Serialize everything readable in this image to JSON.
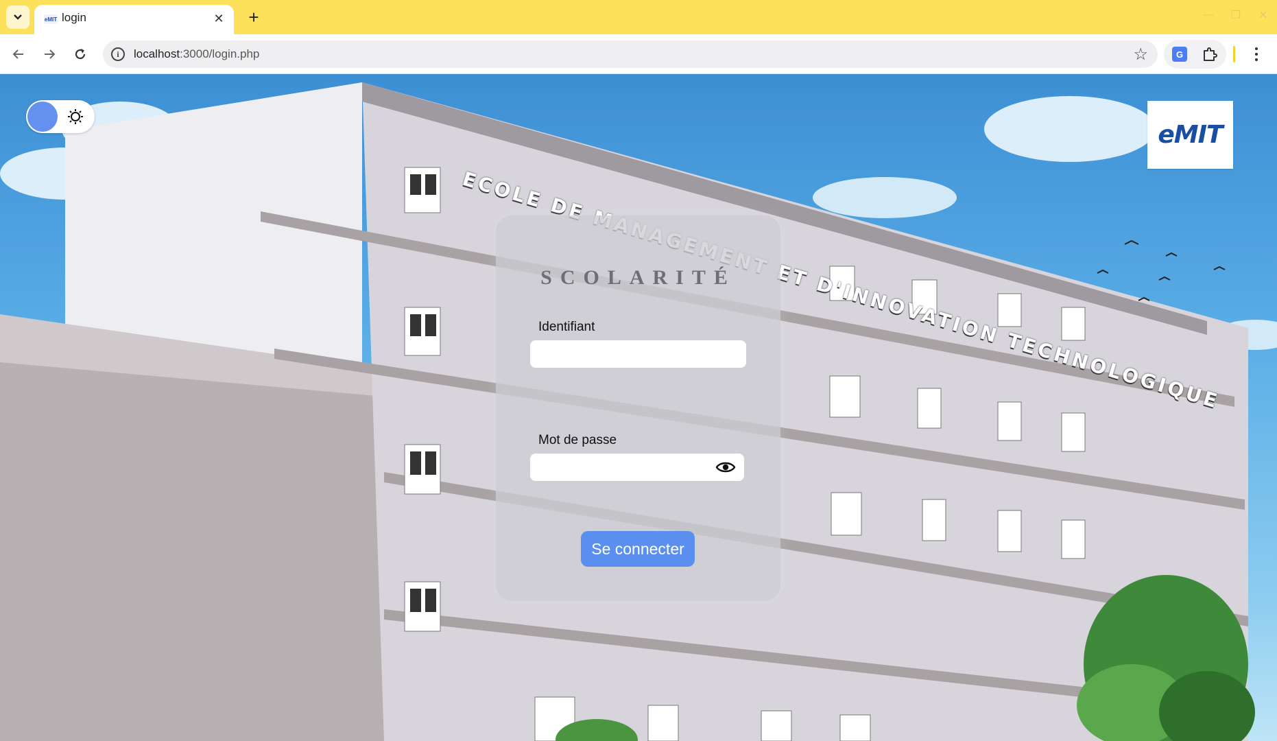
{
  "browser": {
    "tab_title": "login",
    "favicon_text": "eMIT",
    "url_host": "localhost",
    "url_path": ":3000/login.php",
    "new_tab_symbol": "+",
    "close_symbol": "✕"
  },
  "page": {
    "building_sign": "ECOLE DE MANAGEMENT ET D'INNOVATION TECHNOLOGIQUE",
    "logo": {
      "text": "eMIT"
    }
  },
  "login": {
    "title": "SCOLARITÉ",
    "username_label": "Identifiant",
    "username_value": "",
    "password_label": "Mot de passe",
    "password_value": "",
    "submit_label": "Se connecter"
  },
  "theme": {
    "accent": "#5a8ff0",
    "toggle_knob": "#6590f0",
    "tabbar": "#fde15b",
    "mode": "light"
  },
  "icons": [
    "tab-dropdown-icon",
    "back-icon",
    "forward-icon",
    "reload-icon",
    "info-icon",
    "bookmark-star-icon",
    "google-translate-icon",
    "extensions-puzzle-icon",
    "kebab-menu-icon",
    "sun-icon",
    "eye-icon"
  ]
}
